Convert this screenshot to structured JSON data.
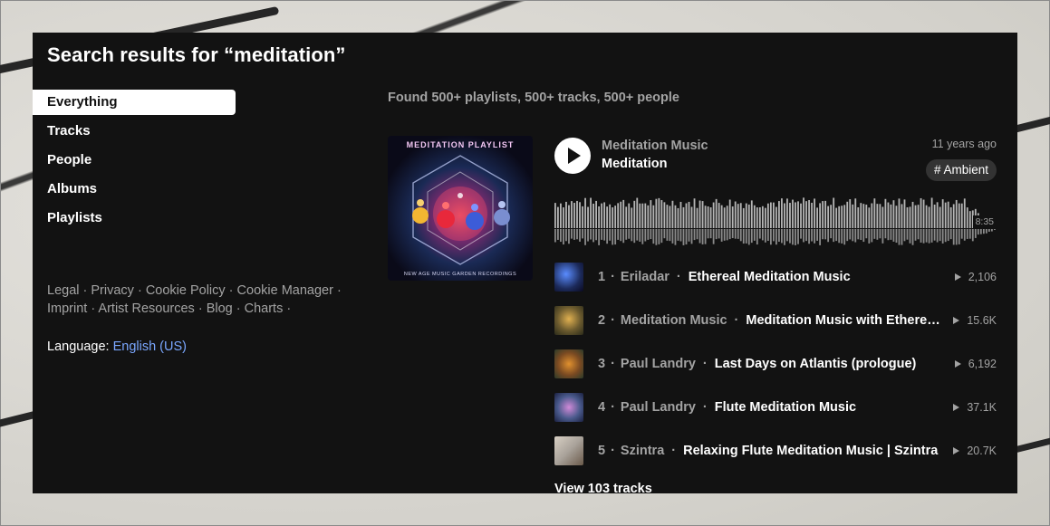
{
  "search": {
    "title": "Search results for “meditation”"
  },
  "sidebar": {
    "items": [
      {
        "label": "Everything",
        "active": true
      },
      {
        "label": "Tracks"
      },
      {
        "label": "People"
      },
      {
        "label": "Albums"
      },
      {
        "label": "Playlists"
      }
    ]
  },
  "footer": {
    "links": [
      "Legal",
      "Privacy",
      "Cookie Policy",
      "Cookie Manager",
      "Imprint",
      "Artist Resources",
      "Blog",
      "Charts"
    ],
    "separator": " · ",
    "language_label": "Language:",
    "language_value": "English (US)"
  },
  "results": {
    "summary": "Found 500+ playlists, 500+ tracks, 500+ people"
  },
  "playlist": {
    "artwork_title": "MEDITATION PLAYLIST",
    "artwork_subtitle": "NEW AGE MUSIC GARDEN RECORDINGS",
    "artist": "Meditation Music",
    "title": "Meditation",
    "posted": "11 years ago",
    "tag": "# Ambient",
    "duration": "8:35",
    "view_all": "View 103 tracks",
    "tracks": [
      {
        "num": "1",
        "artist": "Eriladar",
        "title": "Ethereal Meditation Music",
        "plays": "2,106",
        "thumb_color": "#1c2a5a"
      },
      {
        "num": "2",
        "artist": "Meditation Music",
        "title": "Meditation Music with Ethereal Voices",
        "plays": "15.6K",
        "thumb_color": "#6b5a2e"
      },
      {
        "num": "3",
        "artist": "Paul Landry",
        "title": "Last Days on Atlantis (prologue)",
        "plays": "6,192",
        "thumb_color": "#7a4a22"
      },
      {
        "num": "4",
        "artist": "Paul Landry",
        "title": "Flute Meditation Music",
        "plays": "37.1K",
        "thumb_color": "#4a5a8c"
      },
      {
        "num": "5",
        "artist": "Szintra",
        "title": "Relaxing Flute Meditation Music | Szintra",
        "plays": "20.7K",
        "thumb_color": "#a9a29a"
      }
    ]
  },
  "colors": {
    "panel": "#121212",
    "muted": "#a3a3a3",
    "link": "#7aa7ff",
    "waveform": "#b5b5b5"
  }
}
